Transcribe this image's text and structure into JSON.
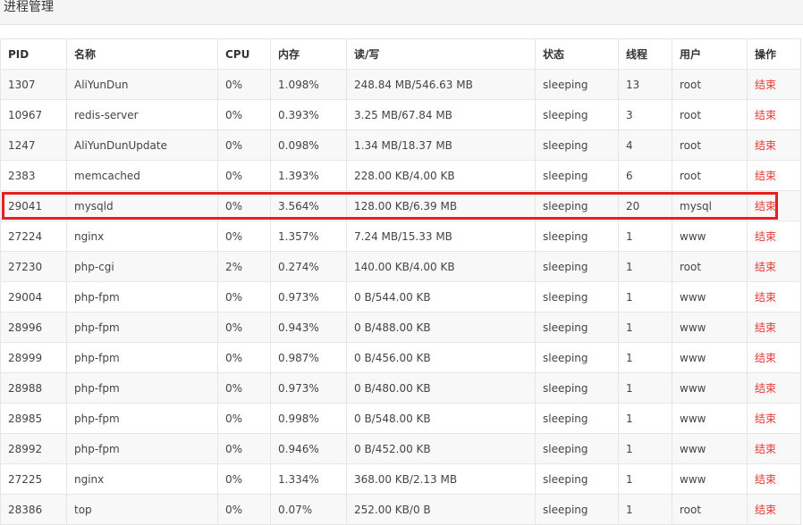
{
  "page_title": "进程管理",
  "headers": {
    "pid": "PID",
    "name": "名称",
    "cpu": "CPU",
    "mem": "内存",
    "io": "读/写",
    "state": "状态",
    "threads": "线程",
    "user": "用户",
    "action": "操作"
  },
  "rows": [
    {
      "pid": "1307",
      "name": "AliYunDun",
      "cpu": "0%",
      "mem": "1.098%",
      "io": "248.84 MB/546.63 MB",
      "state": "sleeping",
      "threads": "13",
      "user": "root",
      "action": "结束"
    },
    {
      "pid": "10967",
      "name": "redis-server",
      "cpu": "0%",
      "mem": "0.393%",
      "io": "3.25 MB/67.84 MB",
      "state": "sleeping",
      "threads": "3",
      "user": "root",
      "action": "结束"
    },
    {
      "pid": "1247",
      "name": "AliYunDunUpdate",
      "cpu": "0%",
      "mem": "0.098%",
      "io": "1.34 MB/18.37 MB",
      "state": "sleeping",
      "threads": "4",
      "user": "root",
      "action": "结束"
    },
    {
      "pid": "2383",
      "name": "memcached",
      "cpu": "0%",
      "mem": "1.393%",
      "io": "228.00 KB/4.00 KB",
      "state": "sleeping",
      "threads": "6",
      "user": "root",
      "action": "结束"
    },
    {
      "pid": "29041",
      "name": "mysqld",
      "cpu": "0%",
      "mem": "3.564%",
      "io": "128.00 KB/6.39 MB",
      "state": "sleeping",
      "threads": "20",
      "user": "mysql",
      "action": "结束"
    },
    {
      "pid": "27224",
      "name": "nginx",
      "cpu": "0%",
      "mem": "1.357%",
      "io": "7.24 MB/15.33 MB",
      "state": "sleeping",
      "threads": "1",
      "user": "www",
      "action": "结束"
    },
    {
      "pid": "27230",
      "name": "php-cgi",
      "cpu": "2%",
      "mem": "0.274%",
      "io": "140.00 KB/4.00 KB",
      "state": "sleeping",
      "threads": "1",
      "user": "root",
      "action": "结束"
    },
    {
      "pid": "29004",
      "name": "php-fpm",
      "cpu": "0%",
      "mem": "0.973%",
      "io": "0 B/544.00 KB",
      "state": "sleeping",
      "threads": "1",
      "user": "www",
      "action": "结束"
    },
    {
      "pid": "28996",
      "name": "php-fpm",
      "cpu": "0%",
      "mem": "0.943%",
      "io": "0 B/488.00 KB",
      "state": "sleeping",
      "threads": "1",
      "user": "www",
      "action": "结束"
    },
    {
      "pid": "28999",
      "name": "php-fpm",
      "cpu": "0%",
      "mem": "0.987%",
      "io": "0 B/456.00 KB",
      "state": "sleeping",
      "threads": "1",
      "user": "www",
      "action": "结束"
    },
    {
      "pid": "28988",
      "name": "php-fpm",
      "cpu": "0%",
      "mem": "0.973%",
      "io": "0 B/480.00 KB",
      "state": "sleeping",
      "threads": "1",
      "user": "www",
      "action": "结束"
    },
    {
      "pid": "28985",
      "name": "php-fpm",
      "cpu": "0%",
      "mem": "0.998%",
      "io": "0 B/548.00 KB",
      "state": "sleeping",
      "threads": "1",
      "user": "www",
      "action": "结束"
    },
    {
      "pid": "28992",
      "name": "php-fpm",
      "cpu": "0%",
      "mem": "0.946%",
      "io": "0 B/452.00 KB",
      "state": "sleeping",
      "threads": "1",
      "user": "www",
      "action": "结束"
    },
    {
      "pid": "27225",
      "name": "nginx",
      "cpu": "0%",
      "mem": "1.334%",
      "io": "368.00 KB/2.13 MB",
      "state": "sleeping",
      "threads": "1",
      "user": "www",
      "action": "结束"
    },
    {
      "pid": "28386",
      "name": "top",
      "cpu": "0%",
      "mem": "0.07%",
      "io": "252.00 KB/0 B",
      "state": "sleeping",
      "threads": "1",
      "user": "root",
      "action": "结束"
    }
  ],
  "colors": {
    "kill_link": "#e53935",
    "highlight": "#e81f1f"
  }
}
